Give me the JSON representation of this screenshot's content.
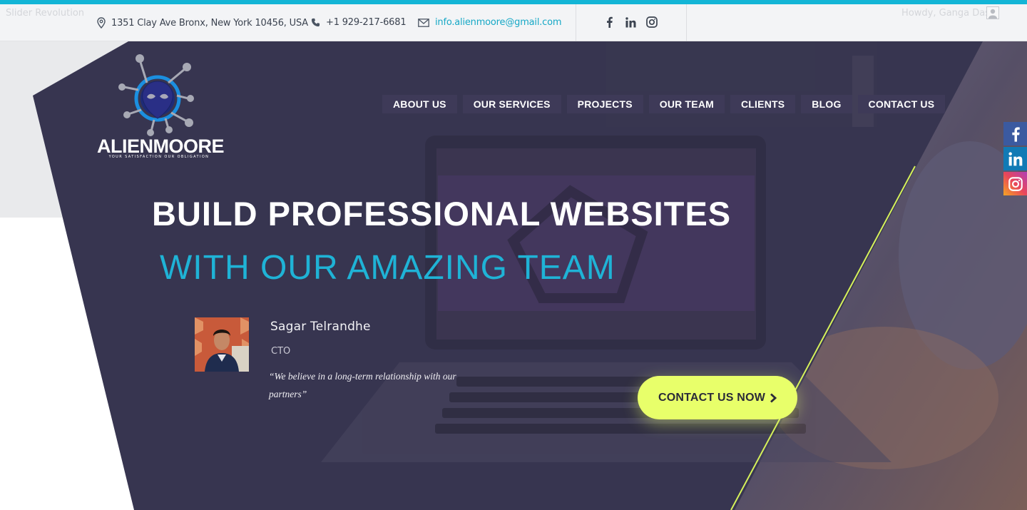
{
  "topbar": {
    "ghost_left": "Slider Revolution",
    "ghost_right": "Howdy, Ganga Das",
    "address": "1351 Clay Ave Bronx, New York 10456, USA",
    "phone": "+1 929-217-6681",
    "email": "info.alienmoore@gmail.com",
    "social": [
      "facebook-icon",
      "linkedin-icon",
      "instagram-icon"
    ]
  },
  "logo": {
    "name": "ALIENMOORE",
    "tagline": "YOUR SATISFACTION OUR OBLIGATION"
  },
  "nav": {
    "items": [
      "ABOUT US",
      "OUR SERVICES",
      "PROJECTS",
      "OUR TEAM",
      "CLIENTS",
      "BLOG",
      "CONTACT US"
    ]
  },
  "hero": {
    "heading": "BUILD PROFESSIONAL WEBSITES",
    "subheading": "WITH OUR AMAZING TEAM",
    "testimonial": {
      "name": "Sagar Telrandhe",
      "role": "CTO",
      "quote": "“We believe in a long-term relationship with our partners”"
    },
    "cta_label": "CONTACT US NOW"
  },
  "side_social": [
    "facebook-icon",
    "linkedin-icon",
    "instagram-icon"
  ],
  "colors": {
    "accent": "#13b5d6",
    "hero_panel": "#373550",
    "cta": "#e8ff6a",
    "diagonal_line": "#d6f25a"
  }
}
